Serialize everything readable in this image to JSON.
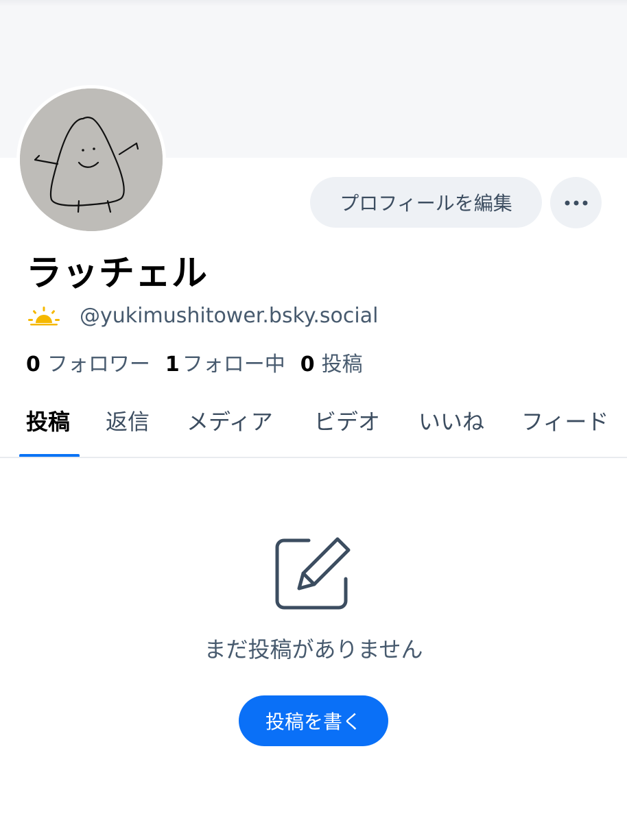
{
  "profile": {
    "display_name": "ラッチェル",
    "handle": "@yukimushitower.bsky.social",
    "handle_emoji": "sun-emoji"
  },
  "actions": {
    "edit_profile_label": "プロフィールを編集",
    "more_label": "more-horizontal-icon"
  },
  "stats": [
    {
      "count": "0",
      "label": "フォロワー"
    },
    {
      "count": "1",
      "label": "フォロー中"
    },
    {
      "count": "0",
      "label": "投稿"
    }
  ],
  "tabs": [
    {
      "label": "投稿",
      "active": true
    },
    {
      "label": "返信",
      "active": false
    },
    {
      "label": "メディア",
      "active": false
    },
    {
      "label": "ビデオ",
      "active": false
    },
    {
      "label": "いいね",
      "active": false
    },
    {
      "label": "フィード",
      "active": false
    }
  ],
  "empty_state": {
    "icon": "compose-edit-icon",
    "message": "まだ投稿がありません",
    "button_label": "投稿を書く"
  },
  "colors": {
    "accent": "#0a70f7",
    "muted_text": "#475a6e",
    "button_bg": "#eef1f5",
    "banner_bg": "#f6f7f9"
  }
}
